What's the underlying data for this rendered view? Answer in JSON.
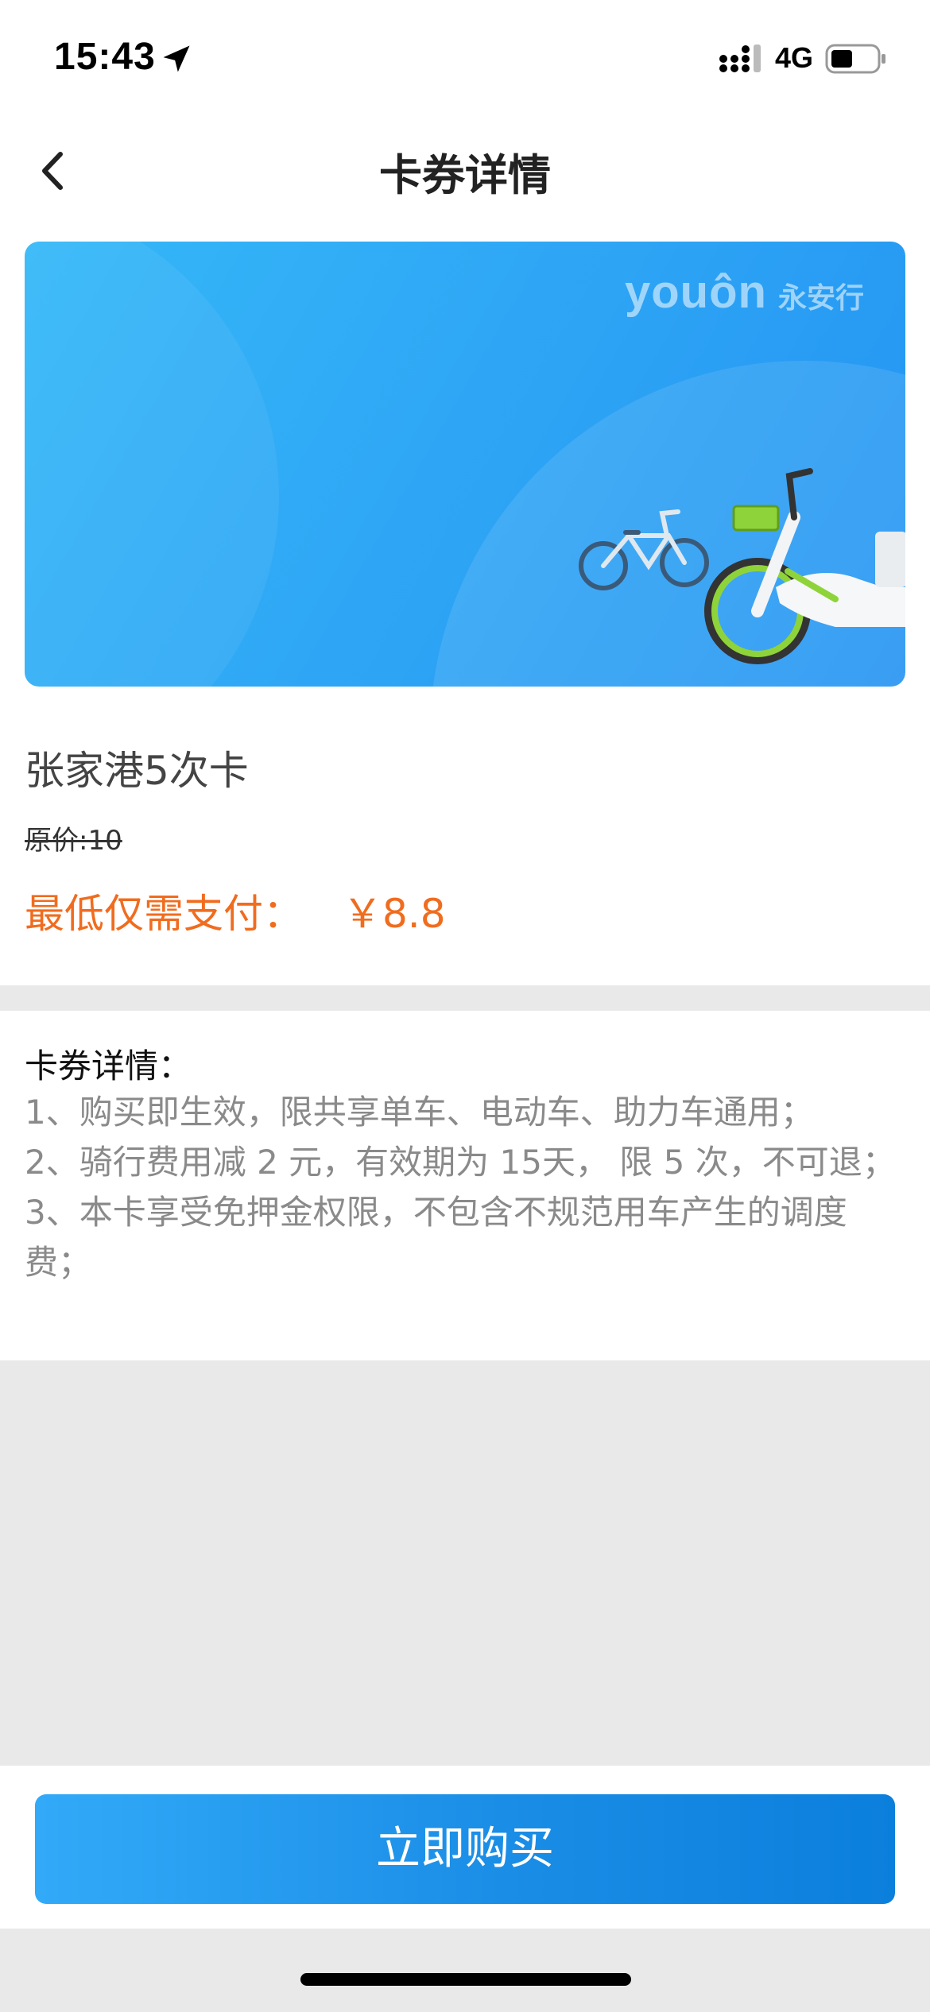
{
  "status_bar": {
    "time": "15:43",
    "network": "4G",
    "icons": [
      "location-arrow-icon",
      "signal-icon",
      "battery-icon"
    ]
  },
  "nav": {
    "title": "卡券详情",
    "back_icon": "chevron-left-icon"
  },
  "banner": {
    "logo_en": "youôn",
    "logo_cn": "永安行",
    "gradient": [
      "#35b8f8",
      "#2394f2"
    ]
  },
  "product": {
    "name": "张家港5次卡",
    "original_price": "原价:10",
    "pay_label": "最低仅需支付：",
    "pay_amount": "￥8.8",
    "accent_color": "#f06c1e"
  },
  "details": {
    "title": "卡券详情：",
    "items": [
      "1、购买即生效，限共享单车、电动车、助力车通用；",
      "2、骑行费用减 2 元，有效期为 15天， 限 5 次，不可退；",
      "3、本卡享受免押金权限，不包含不规范用车产生的调度费；"
    ]
  },
  "actions": {
    "buy_label": "立即购买",
    "button_color": "#1a8de6"
  }
}
